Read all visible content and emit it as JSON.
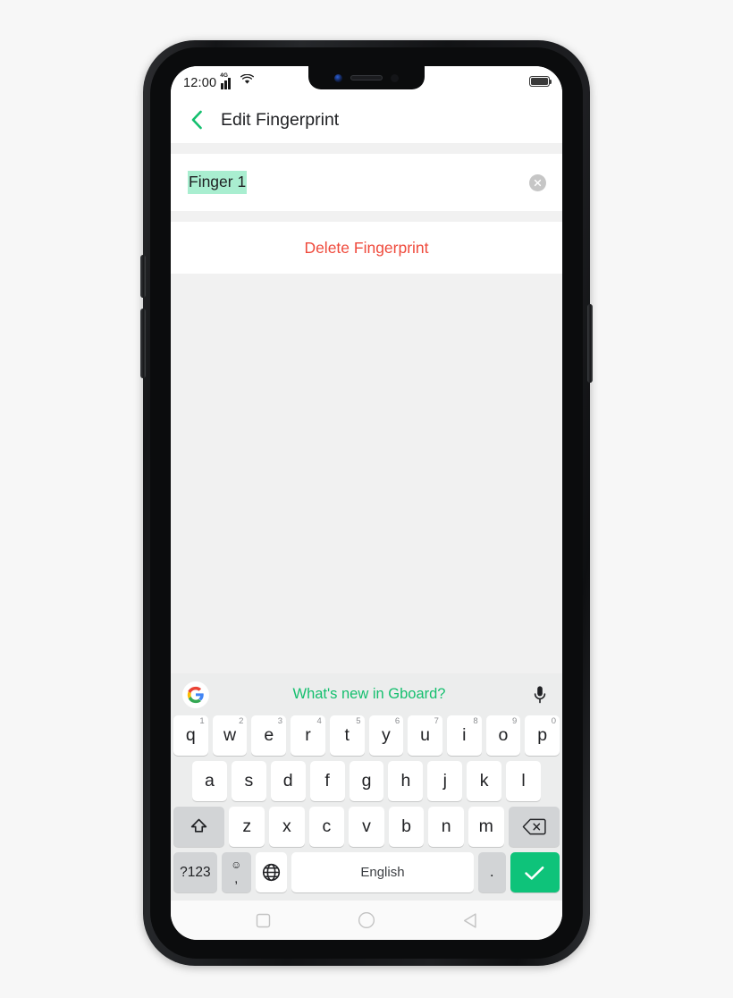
{
  "status_bar": {
    "time": "12:00",
    "network_label": "4G",
    "icons": [
      "signal-icon",
      "wifi-icon",
      "battery-icon"
    ]
  },
  "app_bar": {
    "back_icon": "back-chevron-icon",
    "title": "Edit Fingerprint",
    "accent_color": "#14bf6e"
  },
  "form": {
    "fingerprint_name": "Finger 1",
    "selection_highlight_color": "#a9eed0",
    "clear_icon": "clear-circle-x-icon"
  },
  "actions": {
    "delete_label": "Delete Fingerprint",
    "delete_color": "#ef4a3c"
  },
  "keyboard": {
    "suggestion_text": "What's new in Gboard?",
    "suggestion_color": "#14bf6e",
    "google_logo": "google-g-icon",
    "mic_icon": "microphone-icon",
    "row1": [
      {
        "label": "q",
        "num": "1"
      },
      {
        "label": "w",
        "num": "2"
      },
      {
        "label": "e",
        "num": "3"
      },
      {
        "label": "r",
        "num": "4"
      },
      {
        "label": "t",
        "num": "5"
      },
      {
        "label": "y",
        "num": "6"
      },
      {
        "label": "u",
        "num": "7"
      },
      {
        "label": "i",
        "num": "8"
      },
      {
        "label": "o",
        "num": "9"
      },
      {
        "label": "p",
        "num": "0"
      }
    ],
    "row2": [
      {
        "label": "a"
      },
      {
        "label": "s"
      },
      {
        "label": "d"
      },
      {
        "label": "f"
      },
      {
        "label": "g"
      },
      {
        "label": "h"
      },
      {
        "label": "j"
      },
      {
        "label": "k"
      },
      {
        "label": "l"
      }
    ],
    "row3": [
      {
        "label": "z"
      },
      {
        "label": "x"
      },
      {
        "label": "c"
      },
      {
        "label": "v"
      },
      {
        "label": "b"
      },
      {
        "label": "n"
      },
      {
        "label": "m"
      }
    ],
    "shift_icon": "shift-arrow-icon",
    "backspace_icon": "backspace-icon",
    "symbols_label": "?123",
    "emoji_icon": "emoji-smiley-icon",
    "comma_label": ",",
    "globe_icon": "globe-language-icon",
    "space_label": "English",
    "period_label": ".",
    "enter_icon": "checkmark-icon",
    "enter_color": "#0ec37a"
  },
  "nav_bar": {
    "recents_icon": "square-recents-icon",
    "home_icon": "circle-home-icon",
    "back_icon": "triangle-back-icon"
  }
}
